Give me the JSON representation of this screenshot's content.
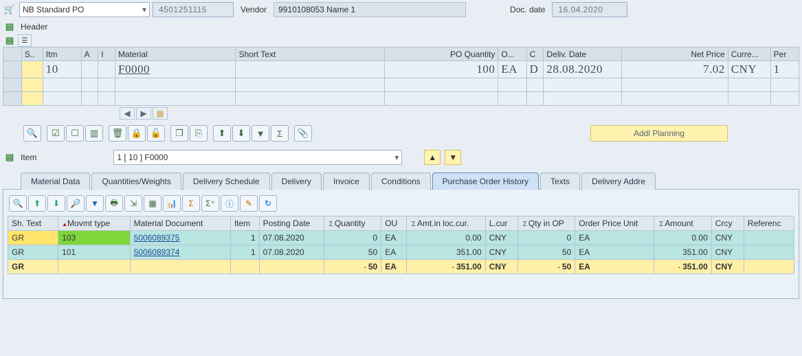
{
  "header": {
    "po_type": "NB Standard PO",
    "po_number": "4501251115",
    "vendor_label": "Vendor",
    "vendor_value": "9910108053 Name 1",
    "doc_date_label": "Doc. date",
    "doc_date_value": "16.04.2020",
    "header_label": "Header"
  },
  "item_overview": {
    "columns": [
      "S..",
      "Itm",
      "A",
      "I",
      "Material",
      "Short Text",
      "PO Quantity",
      "O...",
      "C",
      "Deliv. Date",
      "Net Price",
      "Curre...",
      "Per"
    ],
    "row": {
      "itm": "10",
      "material": "F0000",
      "short_text": "",
      "po_qty": "100",
      "uom": "EA",
      "cat": "D",
      "deliv_date": "28.08.2020",
      "net_price": "7.02",
      "currency": "CNY",
      "per": "1"
    }
  },
  "addl_btn": "Addl Planning",
  "item_detail": {
    "label": "Item",
    "selector": "1 [ 10 ] F0000"
  },
  "tabs": [
    "Material Data",
    "Quantities/Weights",
    "Delivery Schedule",
    "Delivery",
    "Invoice",
    "Conditions",
    "Purchase Order History",
    "Texts",
    "Delivery Addre"
  ],
  "active_tab": 6,
  "history": {
    "columns": [
      "Sh. Text",
      "Movmt type",
      "Material Document",
      "Item",
      "Posting Date",
      "Quantity",
      "OU",
      "Amt.in loc.cur.",
      "L.cur",
      "Qty in OP",
      "Order Price Unit",
      "Amount",
      "Crcy",
      "Referenc"
    ],
    "rows": [
      {
        "sh": "GR",
        "mvt": "103",
        "doc": "5006089375",
        "item": "1",
        "date": "07.08.2020",
        "qty": "0",
        "ou": "EA",
        "amt": "0.00",
        "lcur": "CNY",
        "qtyop": "0",
        "opu": "EA",
        "amount": "0.00",
        "crcy": "CNY"
      },
      {
        "sh": "GR",
        "mvt": "101",
        "doc": "5006089374",
        "item": "1",
        "date": "07.08.2020",
        "qty": "50",
        "ou": "EA",
        "amt": "351.00",
        "lcur": "CNY",
        "qtyop": "50",
        "opu": "EA",
        "amount": "351.00",
        "crcy": "CNY"
      }
    ],
    "sum": {
      "sh": "GR",
      "qty": "50",
      "ou": "EA",
      "amt": "351.00",
      "lcur": "CNY",
      "qtyop": "50",
      "opu": "EA",
      "amount": "351.00",
      "crcy": "CNY"
    }
  }
}
